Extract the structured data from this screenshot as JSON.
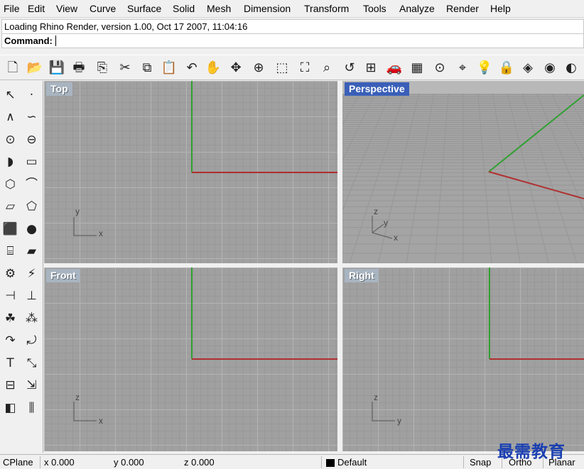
{
  "menu": [
    "File",
    "Edit",
    "View",
    "Curve",
    "Surface",
    "Solid",
    "Mesh",
    "Dimension",
    "Transform",
    "Tools",
    "Analyze",
    "Render",
    "Help"
  ],
  "history_line": "Loading Rhino Render, version 1.00, Oct 17 2007, 11:04:16",
  "command": {
    "label": "Command:",
    "value": ""
  },
  "toolbar": [
    {
      "name": "new",
      "glyph": "🗋"
    },
    {
      "name": "open",
      "glyph": "📂"
    },
    {
      "name": "save",
      "glyph": "💾"
    },
    {
      "name": "print",
      "glyph": "🖶"
    },
    {
      "name": "import",
      "glyph": "⎘"
    },
    {
      "name": "cut",
      "glyph": "✂"
    },
    {
      "name": "copy",
      "glyph": "⧉"
    },
    {
      "name": "paste",
      "glyph": "📋"
    },
    {
      "name": "undo",
      "glyph": "↶"
    },
    {
      "name": "pan",
      "glyph": "✋"
    },
    {
      "name": "rotate-view",
      "glyph": "✥"
    },
    {
      "name": "zoom-dynamic",
      "glyph": "⊕"
    },
    {
      "name": "zoom-window",
      "glyph": "⬚"
    },
    {
      "name": "zoom-extents",
      "glyph": "⛶"
    },
    {
      "name": "zoom-selected",
      "glyph": "⌕"
    },
    {
      "name": "undo-view",
      "glyph": "↺"
    },
    {
      "name": "four-viewports",
      "glyph": "⊞"
    },
    {
      "name": "render",
      "glyph": "🚗"
    },
    {
      "name": "render-grid",
      "glyph": "▦"
    },
    {
      "name": "select-points",
      "glyph": "⊙"
    },
    {
      "name": "object-snap",
      "glyph": "⌖"
    },
    {
      "name": "light",
      "glyph": "💡"
    },
    {
      "name": "lock",
      "glyph": "🔒"
    },
    {
      "name": "properties",
      "glyph": "◈"
    },
    {
      "name": "color-wheel",
      "glyph": "◉"
    },
    {
      "name": "render-sphere",
      "glyph": "◐"
    }
  ],
  "sidebar": [
    {
      "name": "select",
      "glyph": "↖"
    },
    {
      "name": "point",
      "glyph": "·"
    },
    {
      "name": "polyline",
      "glyph": "∧"
    },
    {
      "name": "curve",
      "glyph": "∽"
    },
    {
      "name": "circle",
      "glyph": "⊙"
    },
    {
      "name": "ellipse",
      "glyph": "⊖"
    },
    {
      "name": "arc",
      "glyph": "◗"
    },
    {
      "name": "rectangle",
      "glyph": "▭"
    },
    {
      "name": "polygon",
      "glyph": "⬡"
    },
    {
      "name": "fillet",
      "glyph": "⌒"
    },
    {
      "name": "surface-points",
      "glyph": "▱"
    },
    {
      "name": "surface-edge",
      "glyph": "⬠"
    },
    {
      "name": "box",
      "glyph": "⬛"
    },
    {
      "name": "sphere",
      "glyph": "●"
    },
    {
      "name": "cylinder",
      "glyph": "⌸"
    },
    {
      "name": "mesh-plane",
      "glyph": "▰"
    },
    {
      "name": "gear",
      "glyph": "⚙"
    },
    {
      "name": "explode",
      "glyph": "⚡"
    },
    {
      "name": "trim",
      "glyph": "⊣"
    },
    {
      "name": "split",
      "glyph": "⊥"
    },
    {
      "name": "boolean",
      "glyph": "☘"
    },
    {
      "name": "group",
      "glyph": "⁂"
    },
    {
      "name": "move",
      "glyph": "↷"
    },
    {
      "name": "rotate",
      "glyph": "⤾"
    },
    {
      "name": "text",
      "glyph": "T"
    },
    {
      "name": "dimension",
      "glyph": "⤡"
    },
    {
      "name": "array",
      "glyph": "⊟"
    },
    {
      "name": "transform",
      "glyph": "⇲"
    },
    {
      "name": "solid-tools",
      "glyph": "◧"
    },
    {
      "name": "analyze",
      "glyph": "⫼"
    }
  ],
  "viewports": [
    {
      "name": "Top",
      "active": false,
      "axes": [
        "x",
        "y"
      ]
    },
    {
      "name": "Perspective",
      "active": true,
      "axes": [
        "x",
        "y",
        "z"
      ]
    },
    {
      "name": "Front",
      "active": false,
      "axes": [
        "x",
        "z"
      ]
    },
    {
      "name": "Right",
      "active": false,
      "axes": [
        "y",
        "z"
      ]
    }
  ],
  "status": {
    "cplane": "CPlane",
    "x": "x 0.000",
    "y": "y 0.000",
    "z": "z 0.000",
    "layer": "Default",
    "snap": "Snap",
    "ortho": "Ortho",
    "planar": "Planar"
  },
  "colors": {
    "x_axis": "#b03030",
    "y_axis": "#30a030",
    "active_title": "#3a5fb8"
  },
  "watermark": "最需教育"
}
